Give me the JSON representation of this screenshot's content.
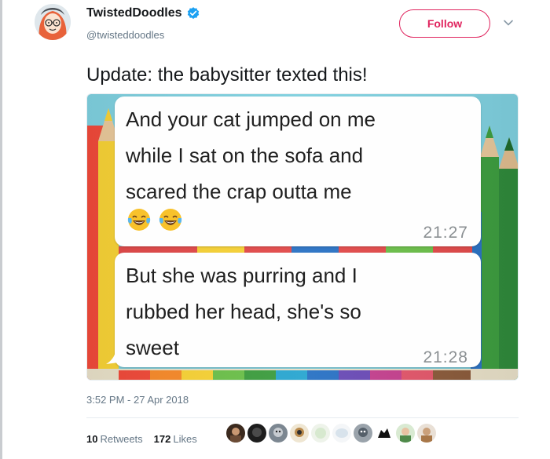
{
  "author": {
    "display_name": "TwistedDoodles",
    "handle": "@twisteddoodles",
    "verified": true,
    "avatar_icon": "cartoon-woman-avatar-icon"
  },
  "actions": {
    "follow_label": "Follow",
    "more_icon": "chevron-down-icon",
    "accent_color": "#e0245e"
  },
  "tweet": {
    "text": "Update: the babysitter texted this!"
  },
  "media": {
    "background": "colored-pencils",
    "messages": [
      {
        "lines": [
          "And your cat jumped on me",
          "while I sat on the sofa and",
          "scared the crap outta me"
        ],
        "emojis": [
          "tears-of-joy-emoji",
          "tears-of-joy-emoji"
        ],
        "time": "21:27"
      },
      {
        "lines": [
          "But she was purring and I",
          "rubbed her head, she's so",
          "sweet"
        ],
        "emojis": [],
        "time": "21:28"
      }
    ]
  },
  "footer": {
    "timestamp": "3:52 PM - 27 Apr 2018",
    "retweets_count": "10",
    "retweets_label": "Retweets",
    "likes_count": "172",
    "likes_label": "Likes",
    "liker_avatars": [
      "avatar-1",
      "avatar-2",
      "avatar-3",
      "avatar-4",
      "avatar-5",
      "avatar-6",
      "avatar-7",
      "avatar-8",
      "avatar-9"
    ]
  }
}
